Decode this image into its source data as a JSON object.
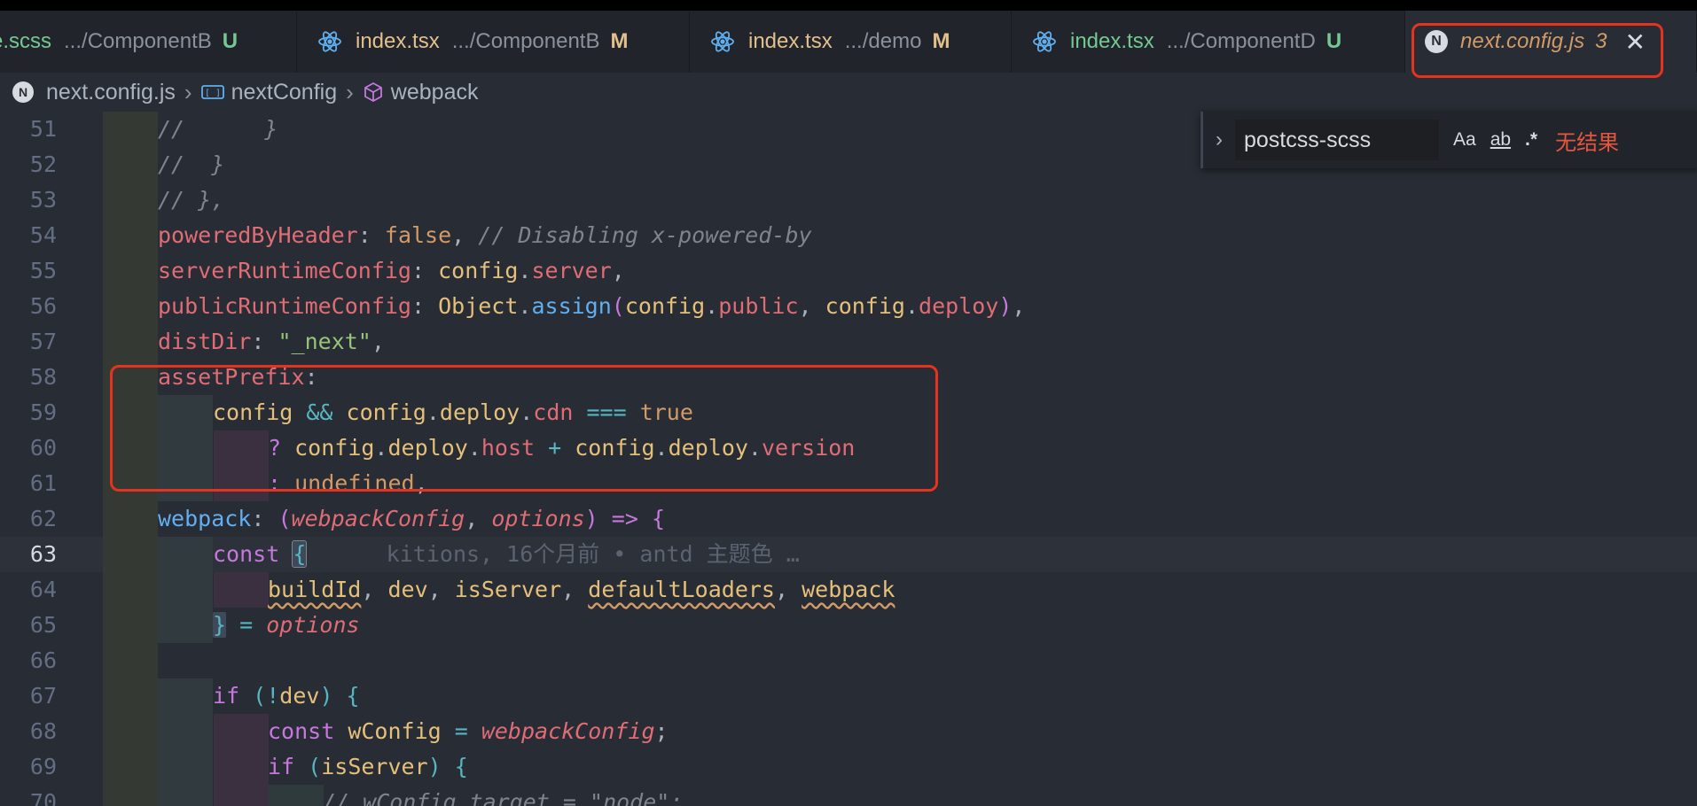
{
  "tabs": [
    {
      "name": "e.scss",
      "desc": ".../ComponentB",
      "status": "U",
      "status_color": "#73c991",
      "name_color": "#73c991",
      "icon": "scss"
    },
    {
      "name": "index.tsx",
      "desc": ".../ComponentB",
      "status": "M",
      "status_color": "#e2c08d",
      "name_color": "#e2c08d",
      "icon": "react-icon"
    },
    {
      "name": "index.tsx",
      "desc": ".../demo",
      "status": "M",
      "status_color": "#e2c08d",
      "name_color": "#e2c08d",
      "icon": "react-icon"
    },
    {
      "name": "index.tsx",
      "desc": ".../ComponentD",
      "status": "U",
      "status_color": "#73c991",
      "name_color": "#73c991",
      "icon": "react-icon"
    },
    {
      "name": "next.config.js",
      "desc": "",
      "status": "3",
      "icon": "nextjs-icon",
      "active": true
    }
  ],
  "breadcrumb": {
    "file": "next.config.js",
    "symbol": "nextConfig",
    "member": "webpack"
  },
  "find": {
    "query": "postcss-scss",
    "match_case": "Aa",
    "whole_word": "ab",
    "regex": ".*",
    "result": "无结果"
  },
  "editor": {
    "current_line": 63,
    "lines": [
      {
        "n": "51",
        "tokens": [
          {
            "t": "//      }",
            "c": "cm"
          }
        ],
        "indent": 1
      },
      {
        "n": "52",
        "tokens": [
          {
            "t": "//  }",
            "c": "cm"
          }
        ],
        "indent": 1
      },
      {
        "n": "53",
        "tokens": [
          {
            "t": "// },",
            "c": "cm"
          }
        ],
        "indent": 1
      },
      {
        "n": "54",
        "tokens": [
          {
            "t": "poweredByHeader",
            "c": "prop"
          },
          {
            "t": ": ",
            "c": "pun"
          },
          {
            "t": "false",
            "c": "num"
          },
          {
            "t": ", ",
            "c": "pun"
          },
          {
            "t": "// Disabling x-powered-by",
            "c": "cm"
          }
        ],
        "indent": 1
      },
      {
        "n": "55",
        "tokens": [
          {
            "t": "serverRuntimeConfig",
            "c": "prop"
          },
          {
            "t": ": ",
            "c": "pun"
          },
          {
            "t": "config",
            "c": "var"
          },
          {
            "t": ".",
            "c": "pun"
          },
          {
            "t": "server",
            "c": "prop"
          },
          {
            "t": ",",
            "c": "pun"
          }
        ],
        "indent": 1
      },
      {
        "n": "56",
        "tokens": [
          {
            "t": "publicRuntimeConfig",
            "c": "prop"
          },
          {
            "t": ": ",
            "c": "pun"
          },
          {
            "t": "Object",
            "c": "var"
          },
          {
            "t": ".",
            "c": "pun"
          },
          {
            "t": "assign",
            "c": "fn"
          },
          {
            "t": "(",
            "c": "kw"
          },
          {
            "t": "config",
            "c": "var"
          },
          {
            "t": ".",
            "c": "pun"
          },
          {
            "t": "public",
            "c": "prop"
          },
          {
            "t": ", ",
            "c": "pun"
          },
          {
            "t": "config",
            "c": "var"
          },
          {
            "t": ".",
            "c": "pun"
          },
          {
            "t": "deploy",
            "c": "prop"
          },
          {
            "t": ")",
            "c": "kw"
          },
          {
            "t": ",",
            "c": "pun"
          }
        ],
        "indent": 1
      },
      {
        "n": "57",
        "tokens": [
          {
            "t": "distDir",
            "c": "prop"
          },
          {
            "t": ": ",
            "c": "pun"
          },
          {
            "t": "\"_next\"",
            "c": "str"
          },
          {
            "t": ",",
            "c": "pun"
          }
        ],
        "indent": 1
      },
      {
        "n": "58",
        "tokens": [
          {
            "t": "assetPrefix",
            "c": "prop"
          },
          {
            "t": ":",
            "c": "pun"
          }
        ],
        "indent": 1
      },
      {
        "n": "59",
        "tokens": [
          {
            "t": "config",
            "c": "var"
          },
          {
            "t": " && ",
            "c": "op"
          },
          {
            "t": "config",
            "c": "var"
          },
          {
            "t": ".",
            "c": "pun"
          },
          {
            "t": "deploy",
            "c": "var"
          },
          {
            "t": ".",
            "c": "pun"
          },
          {
            "t": "cdn",
            "c": "prop"
          },
          {
            "t": " === ",
            "c": "op"
          },
          {
            "t": "true",
            "c": "num"
          }
        ],
        "indent": 2
      },
      {
        "n": "60",
        "tokens": [
          {
            "t": "? ",
            "c": "kw"
          },
          {
            "t": "config",
            "c": "var"
          },
          {
            "t": ".",
            "c": "pun"
          },
          {
            "t": "deploy",
            "c": "var"
          },
          {
            "t": ".",
            "c": "pun"
          },
          {
            "t": "host",
            "c": "prop"
          },
          {
            "t": " + ",
            "c": "op"
          },
          {
            "t": "config",
            "c": "var"
          },
          {
            "t": ".",
            "c": "pun"
          },
          {
            "t": "deploy",
            "c": "var"
          },
          {
            "t": ".",
            "c": "pun"
          },
          {
            "t": "version",
            "c": "prop"
          }
        ],
        "indent": 3
      },
      {
        "n": "61",
        "tokens": [
          {
            "t": ": ",
            "c": "kw"
          },
          {
            "t": "undefined",
            "c": "num"
          },
          {
            "t": ",",
            "c": "pun"
          }
        ],
        "indent": 3
      },
      {
        "n": "62",
        "tokens": [
          {
            "t": "webpack",
            "c": "fn"
          },
          {
            "t": ": ",
            "c": "pun"
          },
          {
            "t": "(",
            "c": "kw"
          },
          {
            "t": "webpackConfig",
            "c": "param"
          },
          {
            "t": ", ",
            "c": "pun"
          },
          {
            "t": "options",
            "c": "param"
          },
          {
            "t": ")",
            "c": "kw"
          },
          {
            "t": " => ",
            "c": "kw"
          },
          {
            "t": "{",
            "c": "kw"
          }
        ],
        "indent": 1
      },
      {
        "n": "63",
        "tokens": [
          {
            "t": "const ",
            "c": "kw"
          },
          {
            "t": "{",
            "c": "op brace-hl cursor-brace"
          },
          {
            "t": "      kitions, 16个月前 • antd 主题色 …",
            "c": "blame"
          }
        ],
        "indent": 2
      },
      {
        "n": "64",
        "tokens": [
          {
            "t": "buildId",
            "c": "var squig"
          },
          {
            "t": ", ",
            "c": "pun"
          },
          {
            "t": "dev",
            "c": "var"
          },
          {
            "t": ", ",
            "c": "pun"
          },
          {
            "t": "isServer",
            "c": "var"
          },
          {
            "t": ", ",
            "c": "pun"
          },
          {
            "t": "defaultLoaders",
            "c": "var squig"
          },
          {
            "t": ", ",
            "c": "pun"
          },
          {
            "t": "webpack",
            "c": "var squig"
          }
        ],
        "indent": 3
      },
      {
        "n": "65",
        "tokens": [
          {
            "t": "}",
            "c": "op brace-hl"
          },
          {
            "t": " = ",
            "c": "op"
          },
          {
            "t": "options",
            "c": "param"
          }
        ],
        "indent": 2
      },
      {
        "n": "66",
        "tokens": [],
        "indent": 1
      },
      {
        "n": "67",
        "tokens": [
          {
            "t": "if ",
            "c": "kw"
          },
          {
            "t": "(",
            "c": "op"
          },
          {
            "t": "!",
            "c": "op"
          },
          {
            "t": "dev",
            "c": "var"
          },
          {
            "t": ") ",
            "c": "op"
          },
          {
            "t": "{",
            "c": "op"
          }
        ],
        "indent": 2
      },
      {
        "n": "68",
        "tokens": [
          {
            "t": "const ",
            "c": "kw"
          },
          {
            "t": "wConfig",
            "c": "var"
          },
          {
            "t": " = ",
            "c": "op"
          },
          {
            "t": "webpackConfig",
            "c": "param"
          },
          {
            "t": ";",
            "c": "pun"
          }
        ],
        "indent": 3
      },
      {
        "n": "69",
        "tokens": [
          {
            "t": "if ",
            "c": "kw"
          },
          {
            "t": "(",
            "c": "op"
          },
          {
            "t": "isServer",
            "c": "var"
          },
          {
            "t": ") ",
            "c": "op"
          },
          {
            "t": "{",
            "c": "op"
          }
        ],
        "indent": 3
      },
      {
        "n": "70",
        "tokens": [
          {
            "t": "// wConfig.target = \"node\";",
            "c": "cm"
          }
        ],
        "indent": 4
      }
    ]
  }
}
